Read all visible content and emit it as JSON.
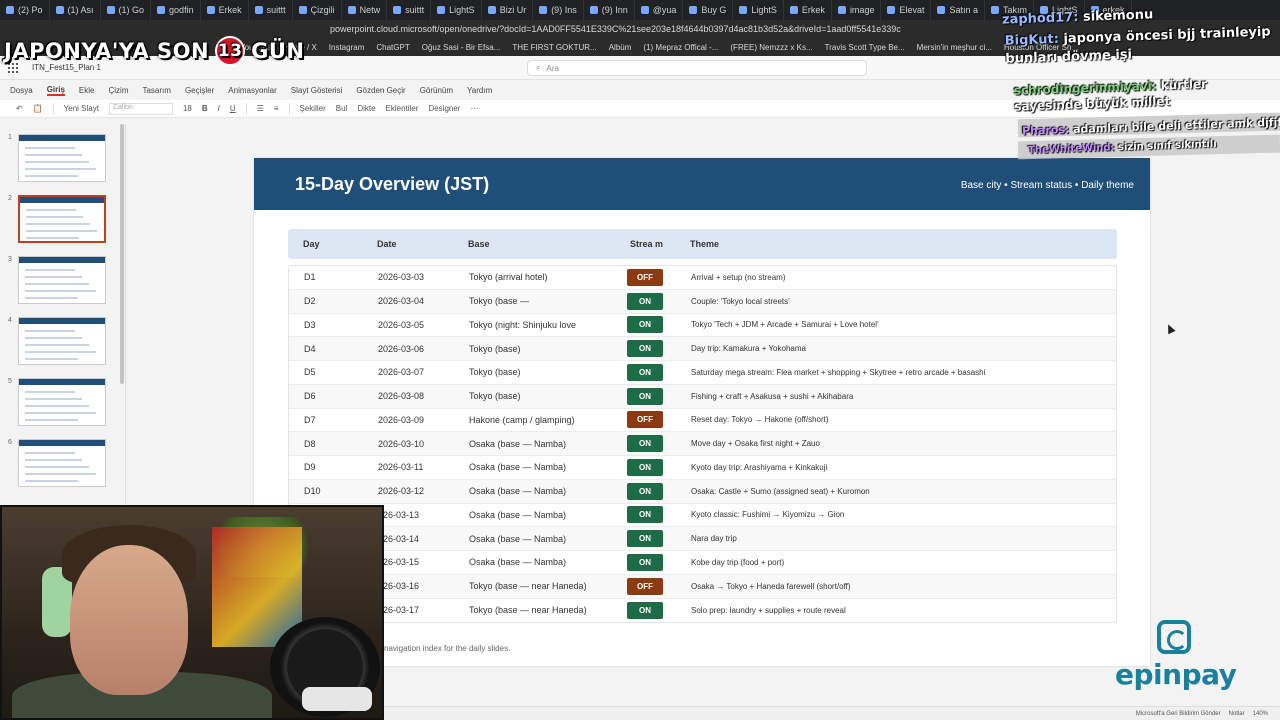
{
  "overlay": {
    "title_left": "JAPONYA'YA SON",
    "days": "13",
    "title_right": "GÜN"
  },
  "browser": {
    "tabs": [
      "(2) Po",
      "(1) Ası",
      "(1) Go",
      "godfin",
      "Erkek",
      "suittt",
      "Çizgili",
      "Netw",
      "suittt",
      "LightS",
      "Bizi Ur",
      "(9) Ins",
      "(9) Inn",
      "@yua",
      "Buy G",
      "LightS",
      "Erkek",
      "image",
      "Elevat",
      "Satın a",
      "Takım",
      "LightS",
      "erkek"
    ],
    "url": "powerpoint.cloud.microsoft/open/onedrive/?docId=1AAD0FF5541E339C%21see203e18f4644b0397d4ac81b3d52a&driveId=1aad0ff5541e339c",
    "bookmarks": [
      "YouTube",
      "Home / X",
      "Instagram",
      "ChatGPT",
      "Oğuz Sasi - Bir Efsa...",
      "THE FIRST GOKTUR...",
      "Albüm",
      "(1) Mepraz Offical -...",
      "(FREE) Nemzzz x Ks...",
      "Travis Scott Type Be...",
      "Mersin'in meşhur ci...",
      "Houston Officer Sh..."
    ]
  },
  "office": {
    "filename": "ITN_Fest15_Plan 1",
    "search_placeholder": "Ara",
    "menu": [
      "Dosya",
      "Giriş",
      "Ekle",
      "Çizim",
      "Tasarım",
      "Geçişler",
      "Animasyonlar",
      "Slayt Gösterisi",
      "Gözden Geçir",
      "Görünüm",
      "Yardım"
    ],
    "ribbon": {
      "new_slide": "Yeni Slayt",
      "font": "Calibri",
      "font_size": "18",
      "shapes": "Şekiller",
      "find": "Bul",
      "dictate": "Dikte",
      "addins": "Eklentiler",
      "designer": "Designer"
    },
    "status": {
      "feedback": "Microsoft'a Geri Bildirim Gönder",
      "notes": "Notlar",
      "zoom": "140%"
    }
  },
  "slide": {
    "title": "15-Day Overview (JST)",
    "subtitle": "Base city • Stream status • Daily theme",
    "headers": {
      "day": "Day",
      "date": "Date",
      "base": "Base",
      "stream": "Strea m",
      "theme": "Theme"
    },
    "rows": [
      {
        "day": "D1",
        "date": "2026-03-03",
        "base": "Tokyo (arrival hotel)",
        "stream": "OFF",
        "theme": "Arrival + setup (no stream)"
      },
      {
        "day": "D2",
        "date": "2026-03-04",
        "base": "Tokyo (base —",
        "stream": "ON",
        "theme": "Couple: 'Tokyo local streets'"
      },
      {
        "day": "D3",
        "date": "2026-03-05",
        "base": "Tokyo (night: Shinjuku love",
        "stream": "ON",
        "theme": "Tokyo 'Tech + JDM + Arcade + Samurai + Love hotel'"
      },
      {
        "day": "D4",
        "date": "2026-03-06",
        "base": "Tokyo (base)",
        "stream": "ON",
        "theme": "Day trip: Kamakura + Yokohama"
      },
      {
        "day": "D5",
        "date": "2026-03-07",
        "base": "Tokyo (base)",
        "stream": "ON",
        "theme": "Saturday mega stream: Flea market + shopping + Skytree + retro arcade + basashi"
      },
      {
        "day": "D6",
        "date": "2026-03-08",
        "base": "Tokyo (base)",
        "stream": "ON",
        "theme": "Fishing + craft + Asakusa + sushi + Akihabara"
      },
      {
        "day": "D7",
        "date": "2026-03-09",
        "base": "Hakone (camp / glamping)",
        "stream": "OFF",
        "theme": "Reset day: Tokyo → Hakone (off/short)"
      },
      {
        "day": "D8",
        "date": "2026-03-10",
        "base": "Osaka (base — Namba)",
        "stream": "ON",
        "theme": "Move day + Osaka first night + Zauo"
      },
      {
        "day": "D9",
        "date": "2026-03-11",
        "base": "Osaka (base — Namba)",
        "stream": "ON",
        "theme": "Kyoto day trip: Arashiyama + Kinkakuji"
      },
      {
        "day": "D10",
        "date": "2026-03-12",
        "base": "Osaka (base — Namba)",
        "stream": "ON",
        "theme": "Osaka: Castle + Sumo (assigned seat) + Kuromon"
      },
      {
        "day": "",
        "date": "026-03-13",
        "base": "Osaka (base — Namba)",
        "stream": "ON",
        "theme": "Kyoto classic: Fushimi → Kiyomizu → Gion"
      },
      {
        "day": "",
        "date": "026-03-14",
        "base": "Osaka (base — Namba)",
        "stream": "ON",
        "theme": "Nara day trip"
      },
      {
        "day": "",
        "date": "026-03-15",
        "base": "Osaka (base — Namba)",
        "stream": "ON",
        "theme": "Kobe day trip (food + port)"
      },
      {
        "day": "",
        "date": "026-03-16",
        "base": "Tokyo (base — near Haneda)",
        "stream": "OFF",
        "theme": "Osaka → Tokyo + Haneda farewell (short/off)"
      },
      {
        "day": "",
        "date": "026-03-17",
        "base": "Tokyo (base — near Haneda)",
        "stream": "ON",
        "theme": "Solo prep: laundry + supplies + route reveal"
      }
    ],
    "footer": "navigation index for the daily slides."
  },
  "colors": {
    "on": "#1e6b48",
    "off": "#8b3a12",
    "header": "#1f4e79",
    "accent": "#c43e1c"
  },
  "chat": [
    {
      "user": "zaphod17:",
      "text": "sikemonu"
    },
    {
      "user": "BigKut:",
      "text": "japonya öncesi bjj trainleyip bunları dövme işi"
    },
    {
      "user": "schrodingerinmiyavi:",
      "text": "kürtler sayesinde büyük millet"
    },
    {
      "user": "Pharos:",
      "text": "adamları bile deli ettiler amk djfjfk"
    },
    {
      "user": "TheWhiteWind:",
      "text": "sizin sınıf sıkıntılı"
    }
  ],
  "sponsor": "epinpay"
}
